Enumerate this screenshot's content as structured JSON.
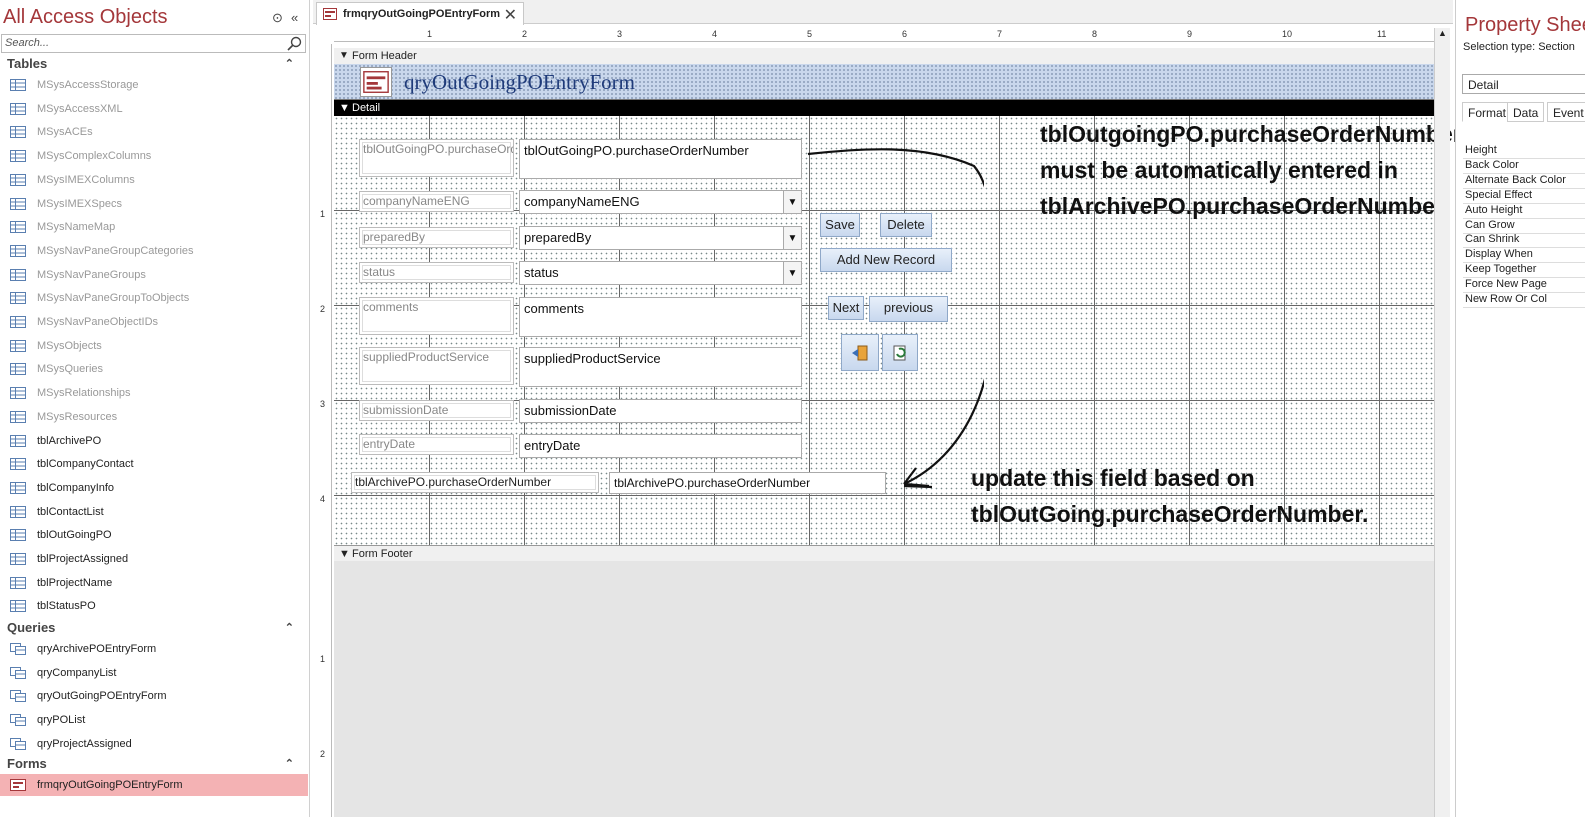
{
  "nav": {
    "title": "All Access Objects",
    "search_placeholder": "Search...",
    "groups": {
      "tables": "Tables",
      "queries": "Queries",
      "forms": "Forms"
    },
    "tables": [
      "MSysAccessStorage",
      "MSysAccessXML",
      "MSysACEs",
      "MSysComplexColumns",
      "MSysIMEXColumns",
      "MSysIMEXSpecs",
      "MSysNameMap",
      "MSysNavPaneGroupCategories",
      "MSysNavPaneGroups",
      "MSysNavPaneGroupToObjects",
      "MSysNavPaneObjectIDs",
      "MSysObjects",
      "MSysQueries",
      "MSysRelationships",
      "MSysResources",
      "tblArchivePO",
      "tblCompanyContact",
      "tblCompanyInfo",
      "tblContactList",
      "tblOutGoingPO",
      "tblProjectAssigned",
      "tblProjectName",
      "tblStatusPO"
    ],
    "queries": [
      "qryArchivePOEntryForm",
      "qryCompanyList",
      "qryOutGoingPOEntryForm",
      "qryPOList",
      "qryProjectAssigned"
    ],
    "forms": [
      "frmqryOutGoingPOEntryForm"
    ]
  },
  "tab": {
    "label": "frmqryOutGoingPOEntryForm",
    "close": "✕"
  },
  "ruler": {
    "h": [
      "1",
      "2",
      "3",
      "4",
      "5",
      "6",
      "7",
      "8",
      "9",
      "10",
      "11"
    ],
    "v": [
      "1",
      "2",
      "3",
      "4",
      "1",
      "2"
    ]
  },
  "form": {
    "header_label": "Form Header",
    "header_title": "qryOutGoingPOEntryForm",
    "detail_label": "Detail",
    "footer_label": "Form Footer",
    "labels": {
      "po": "tblOutGoingPO.purchaseOrderNumber",
      "company": "companyNameENG",
      "prepared": "preparedBy",
      "status": "status",
      "comments": "comments",
      "supplied": "suppliedProductService",
      "submission": "submissionDate",
      "entry": "entryDate",
      "archive": "tblArchivePO.purchaseOrderNumber"
    },
    "fields": {
      "po": "tblOutGoingPO.purchaseOrderNumber",
      "company": "companyNameENG",
      "prepared": "preparedBy",
      "status": "status",
      "comments": "comments",
      "supplied": "suppliedProductService",
      "submission": "submissionDate",
      "entry": "entryDate",
      "archive": "tblArchivePO.purchaseOrderNumber"
    },
    "buttons": {
      "save": "Save",
      "delete": "Delete",
      "add_new": "Add New Record",
      "next": "Next",
      "previous": "previous"
    }
  },
  "notes": {
    "top": [
      "tblOutgoingPO.purchaseOrderNumber",
      "must be automatically entered in",
      "tblArchivePO.purchaseOrderNumber"
    ],
    "bottom": [
      "update this field based on",
      "tblOutGoing.purchaseOrderNumber."
    ]
  },
  "property_sheet": {
    "title": "Property Sheet",
    "selection_type": "Selection type:  Section",
    "selected": "Detail",
    "tabs": [
      "Format",
      "Data",
      "Event"
    ],
    "rows": [
      "Height",
      "Back Color",
      "Alternate Back Color",
      "Special Effect",
      "Auto Height",
      "Can Grow",
      "Can Shrink",
      "Display When",
      "Keep Together",
      "Force New Page",
      "New Row Or Col"
    ]
  },
  "colors": {
    "accent": "#a4373a",
    "selected": "#f4b2b4",
    "header_band": "#c9d7ec"
  }
}
